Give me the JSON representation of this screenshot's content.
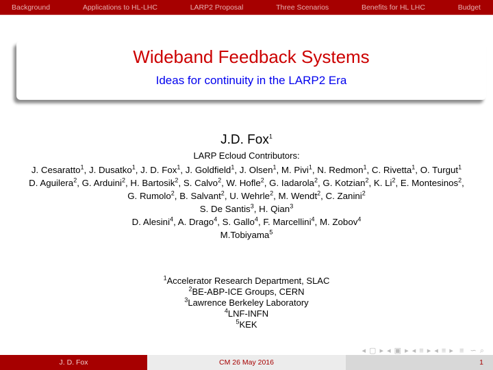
{
  "nav": [
    "Background",
    "Applications to HL-LHC",
    "LARP2 Proposal",
    "Three Scenarios",
    "Benefits for HL LHC",
    "Budget"
  ],
  "title": "Wideband Feedback Systems",
  "subtitle": "Ideas for continuity in the LARP2 Era",
  "author": {
    "name": "J.D. Fox",
    "sup": "1"
  },
  "contributors_label": "LARP Ecloud Contributors:",
  "author_groups": [
    [
      [
        "J. Cesaratto",
        "1"
      ],
      [
        "J. Dusatko",
        "1"
      ],
      [
        "J. D. Fox",
        "1"
      ],
      [
        "J. Goldfield",
        "1"
      ],
      [
        "J. Olsen",
        "1"
      ],
      [
        "M. Pivi",
        "1"
      ],
      [
        "N. Redmon",
        "1"
      ],
      [
        "C. Rivetta",
        "1"
      ],
      [
        "O. Turgut",
        "1"
      ]
    ],
    [
      [
        "D. Aguilera",
        "2"
      ],
      [
        "G. Arduini",
        "2"
      ],
      [
        "H. Bartosik",
        "2"
      ],
      [
        "S. Calvo",
        "2"
      ],
      [
        "W. Hofle",
        "2"
      ],
      [
        "G. Iadarola",
        "2"
      ],
      [
        "G. Kotzian",
        "2"
      ],
      [
        "K. Li",
        "2"
      ],
      [
        "E. Montesinos",
        "2"
      ],
      [
        "G. Rumolo",
        "2"
      ],
      [
        "B. Salvant",
        "2"
      ],
      [
        "U. Wehrle",
        "2"
      ],
      [
        "M. Wendt",
        "2"
      ],
      [
        "C. Zanini",
        "2"
      ]
    ],
    [
      [
        "S. De Santis",
        "3"
      ],
      [
        "H. Qian",
        "3"
      ]
    ],
    [
      [
        "D. Alesini",
        "4"
      ],
      [
        "A. Drago",
        "4"
      ],
      [
        "S. Gallo",
        "4"
      ],
      [
        "F. Marcellini",
        "4"
      ],
      [
        "M. Zobov",
        "4"
      ]
    ],
    [
      [
        "M.Tobiyama",
        "5"
      ]
    ]
  ],
  "affiliations": [
    [
      "1",
      "Accelerator Research Department, SLAC"
    ],
    [
      "2",
      "BE-ABP-ICE Groups, CERN"
    ],
    [
      "3",
      "Lawrence Berkeley Laboratory"
    ],
    [
      "4",
      "LNF-INFN"
    ],
    [
      "5",
      "KEK"
    ]
  ],
  "footer": {
    "author": "J. D. Fox",
    "event": "CM 26 May 2016",
    "page": "1"
  },
  "colors": {
    "accent": "#a60000",
    "title": "#cc0000",
    "subtitle": "#0000ee"
  }
}
